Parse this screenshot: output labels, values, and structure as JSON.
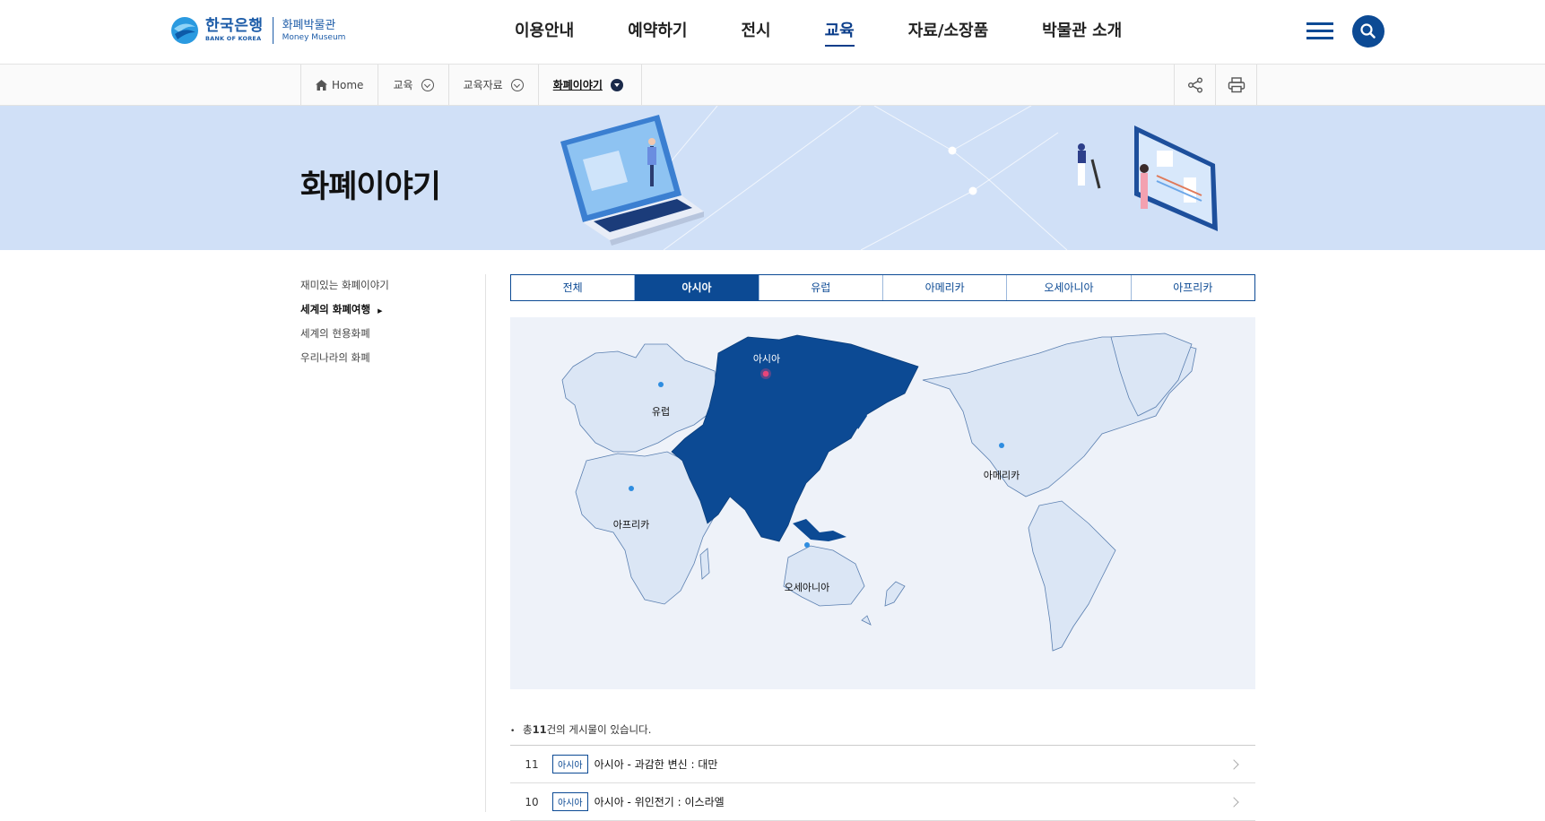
{
  "header": {
    "logo_korean": "한국은행",
    "logo_english": "BANK OF KOREA",
    "museum_korean": "화폐박물관",
    "museum_english": "Money Museum",
    "nav": [
      "이용안내",
      "예약하기",
      "전시",
      "교육",
      "자료/소장품",
      "박물관 소개"
    ],
    "active_nav": "교육",
    "brand_color": "#0c4a94"
  },
  "breadcrumb": {
    "home": "Home",
    "level1": "교육",
    "level2": "교육자료",
    "level3": "화폐이야기"
  },
  "banner": {
    "title": "화폐이야기",
    "background": "#d0e0f7"
  },
  "side_menu": {
    "items": [
      "재미있는 화폐이야기",
      "세계의 화폐여행",
      "세계의 현용화폐",
      "우리나라의 화폐"
    ],
    "active": "세계의 화폐여행"
  },
  "tabs": {
    "items": [
      "전체",
      "아시아",
      "유럽",
      "아메리카",
      "오세아니아",
      "아프리카"
    ],
    "active": "아시아"
  },
  "map": {
    "labels": {
      "asia": "아시아",
      "europe": "유럽",
      "africa": "아프리카",
      "america": "아메리카",
      "oceania": "오세아니아"
    },
    "selected_region": "아시아",
    "land_color": "#dbe6f5",
    "highlight_color": "#0c4a94",
    "marker_selected_color": "#e8457a",
    "marker_color": "#2e8de0"
  },
  "list": {
    "total_prefix": "총",
    "total_count": "11",
    "total_suffix": "건의 게시물이 있습니다.",
    "rows": [
      {
        "num": "11",
        "badge": "아시아",
        "title": "아시아 - 과감한 변신 : 대만"
      },
      {
        "num": "10",
        "badge": "아시아",
        "title": "아시아 - 위인전기 : 이스라엘"
      }
    ]
  }
}
